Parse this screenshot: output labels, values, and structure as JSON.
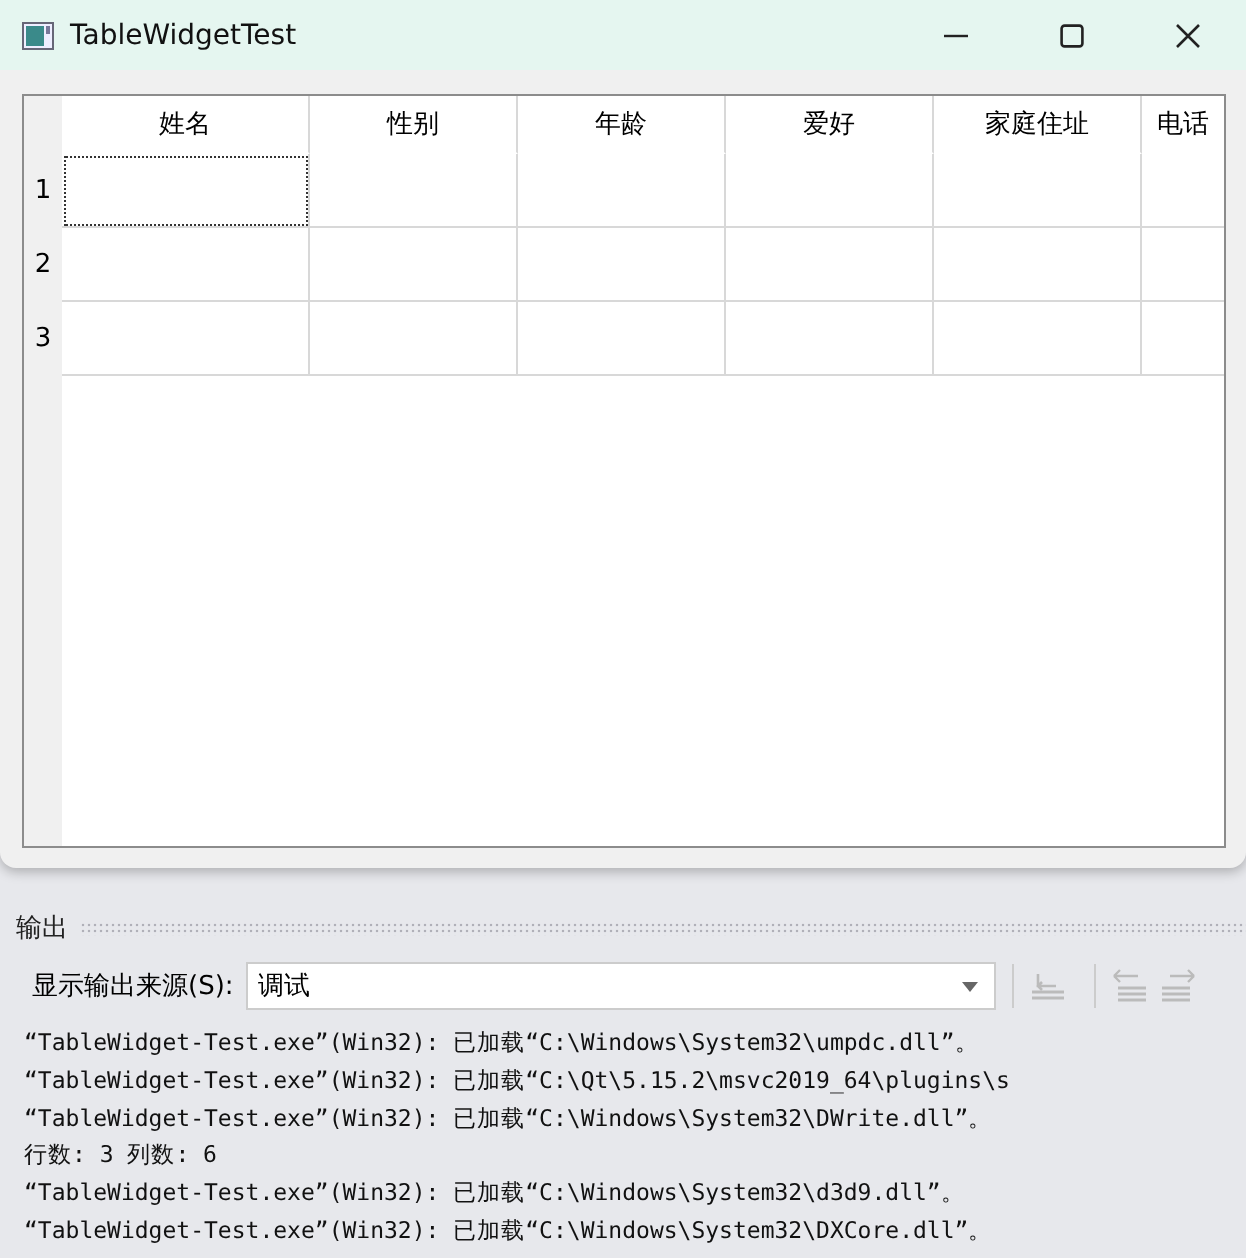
{
  "window": {
    "title": "TableWidgetTest"
  },
  "table": {
    "columns": [
      "姓名",
      "性别",
      "年龄",
      "爱好",
      "家庭住址",
      "电话"
    ],
    "rows": [
      {
        "label": "1",
        "cells": [
          {
            "focused": true
          },
          {
            "focused": false
          },
          {
            "focused": false
          },
          {
            "focused": false
          },
          {
            "focused": false
          },
          {
            "focused": false
          }
        ]
      },
      {
        "label": "2",
        "cells": [
          {
            "focused": false
          },
          {
            "focused": false
          },
          {
            "focused": false
          },
          {
            "focused": false
          },
          {
            "focused": false
          },
          {
            "focused": false
          }
        ]
      },
      {
        "label": "3",
        "cells": [
          {
            "focused": false
          },
          {
            "focused": false
          },
          {
            "focused": false
          },
          {
            "focused": false
          },
          {
            "focused": false
          },
          {
            "focused": false
          }
        ]
      }
    ]
  },
  "output_panel": {
    "title": "输出",
    "source_label": "显示输出来源(S):",
    "source_value": "调试",
    "lines": [
      "“TableWidget-Test.exe”(Win32): 已加载“C:\\Windows\\System32\\umpdc.dll”。",
      "“TableWidget-Test.exe”(Win32): 已加载“C:\\Qt\\5.15.2\\msvc2019_64\\plugins\\s",
      "“TableWidget-Test.exe”(Win32): 已加载“C:\\Windows\\System32\\DWrite.dll”。",
      "行数: 3 列数: 6",
      "“TableWidget-Test.exe”(Win32): 已加载“C:\\Windows\\System32\\d3d9.dll”。",
      "“TableWidget-Test.exe”(Win32): 已加载“C:\\Windows\\System32\\DXCore.dll”。"
    ]
  }
}
